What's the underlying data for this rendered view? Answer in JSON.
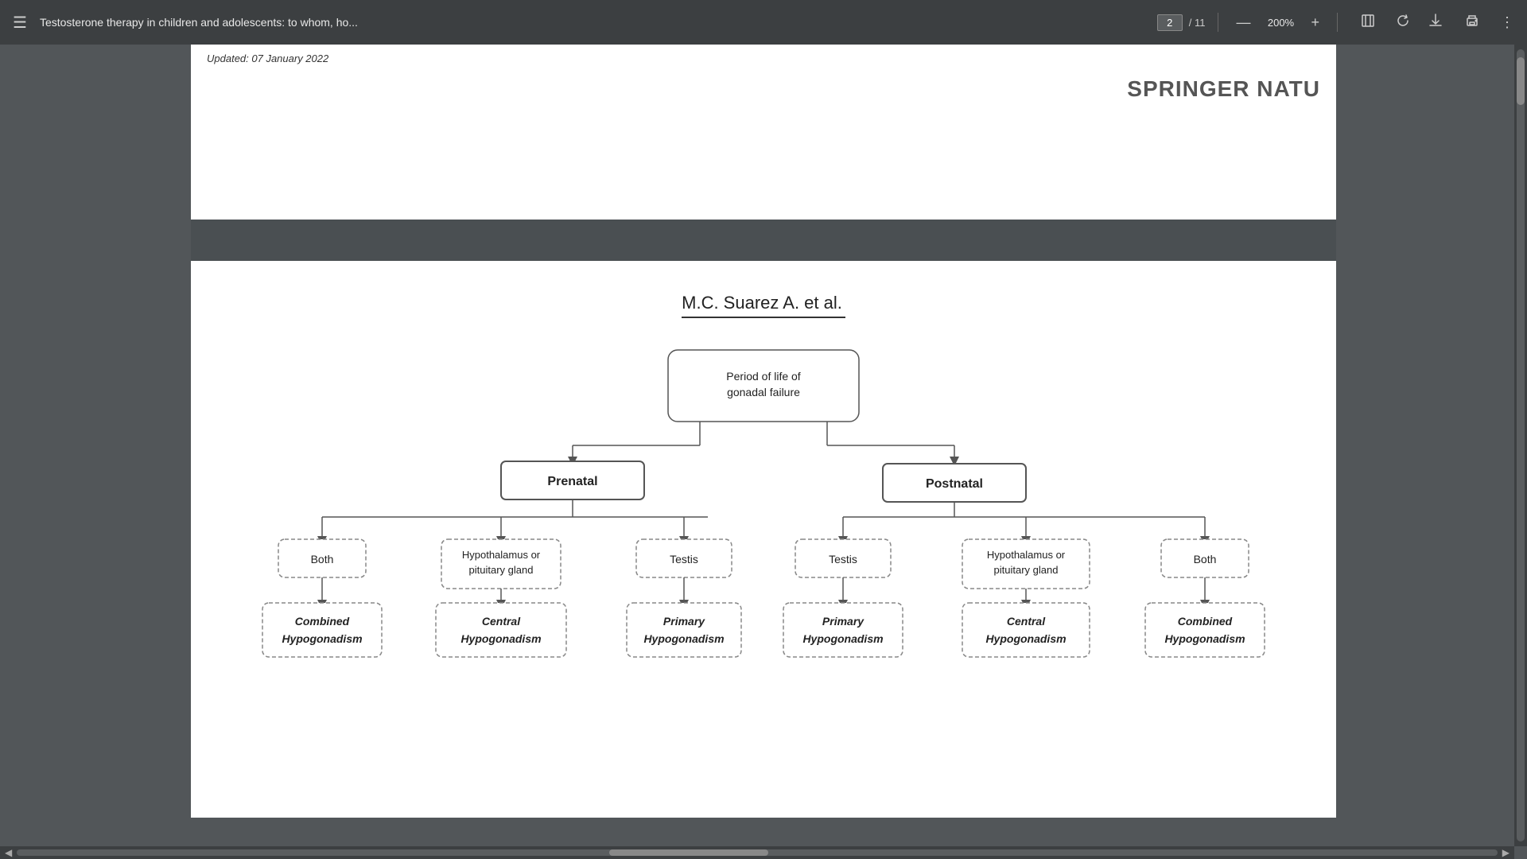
{
  "toolbar": {
    "menu_icon": "☰",
    "title": "Testosterone therapy in children and adolescents: to whom, ho...",
    "current_page": "2",
    "total_pages": "11",
    "zoom": "200%",
    "download_label": "Download",
    "print_label": "Print",
    "more_label": "More"
  },
  "page": {
    "date_text": "Updated: 07 January 2022",
    "springer_logo": "SPRINGER NATU",
    "author_citation": "M.C. Suarez A. et al.",
    "diagram": {
      "root_label": "Period of life of gonadal failure",
      "left_child": "Prenatal",
      "right_child": "Postnatal",
      "prenatal_children": [
        "Both",
        "Hypothalamus or pituitary gland",
        "Testis"
      ],
      "postnatal_children": [
        "Testis",
        "Hypothalamus or pituitary gland",
        "Both"
      ],
      "prenatal_outcomes": [
        "Combined Hypogonadism",
        "Central Hypogonadism",
        "Primary Hypogonadism"
      ],
      "postnatal_outcomes": [
        "Primary Hypogonadism",
        "Central Hypogonadism",
        "Combined Hypogonadism"
      ]
    }
  },
  "scrollbar": {
    "left_arrow": "◀",
    "right_arrow": "▶"
  }
}
